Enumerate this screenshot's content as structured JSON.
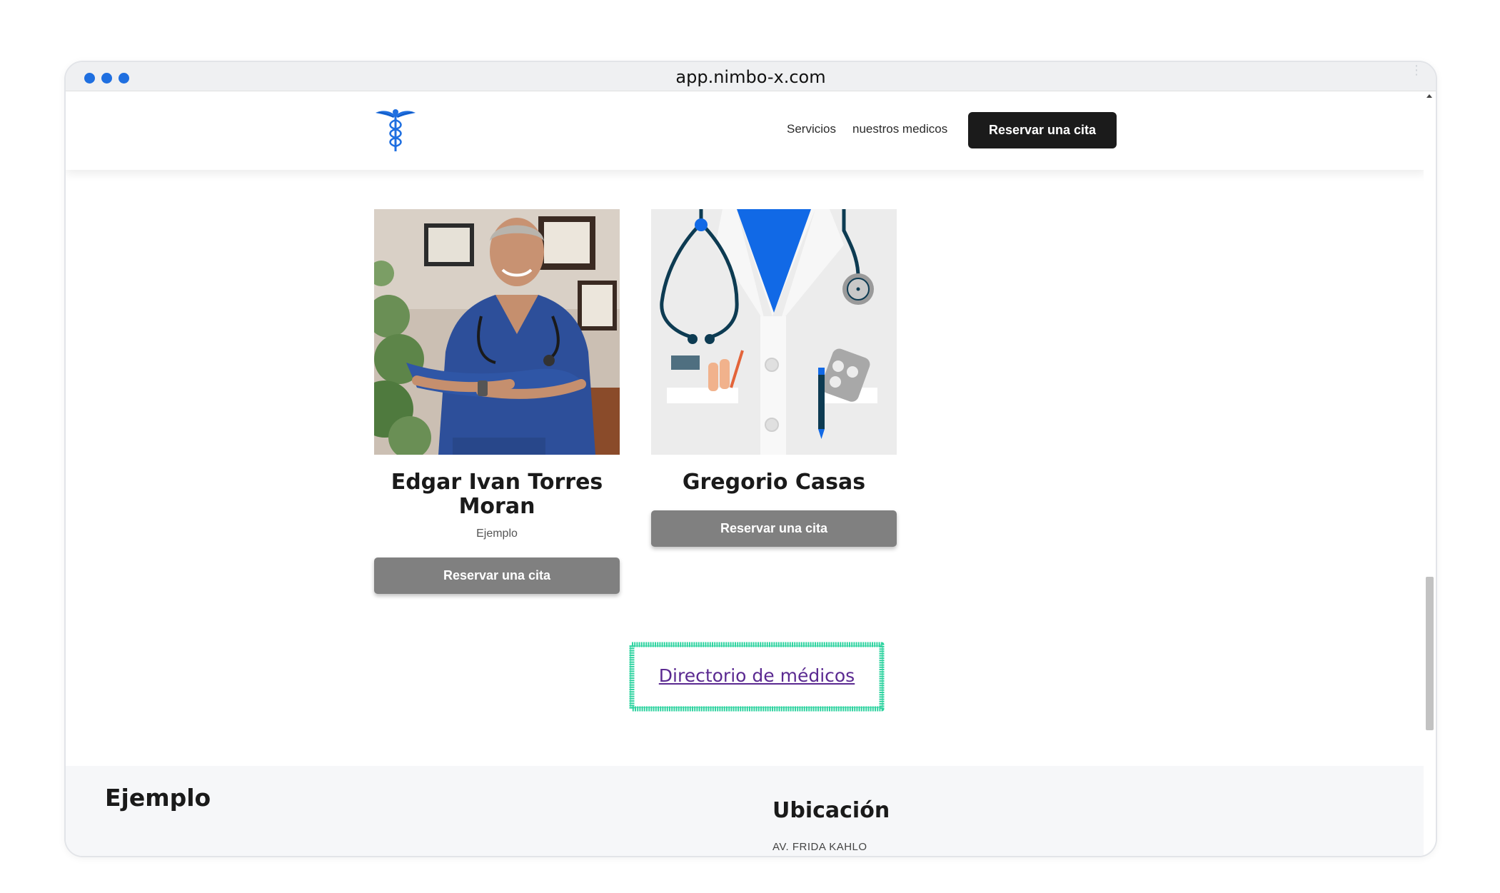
{
  "browser": {
    "url": "app.nimbo-x.com"
  },
  "navbar": {
    "logo_icon": "caduceus-icon",
    "links": [
      "Servicios",
      "nuestros medicos"
    ],
    "cta_label": "Reservar una cita"
  },
  "doctors": [
    {
      "name": "Edgar Ivan Torres Moran",
      "subtitle": "Ejemplo",
      "button_label": "Reservar una cita",
      "photo": "doctor-photo"
    },
    {
      "name": "Gregorio Casas",
      "subtitle": "",
      "button_label": "Reservar una cita",
      "photo": "doctor-coat-illustration"
    }
  ],
  "directory": {
    "link_label": "Directorio de médicos",
    "highlight_color": "#2fd3a0"
  },
  "footer": {
    "title": "Ejemplo",
    "location_heading": "Ubicación",
    "address": "AV. FRIDA KAHLO"
  },
  "colors": {
    "accent": "#1f6fe0",
    "cta_bg": "#1b1b1b",
    "card_button_bg": "#808080",
    "link": "#5b2a91"
  }
}
